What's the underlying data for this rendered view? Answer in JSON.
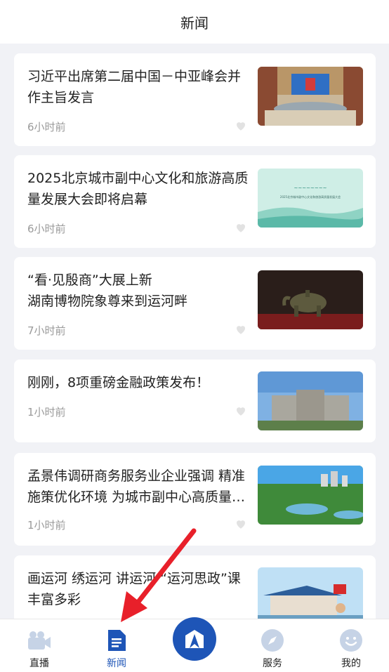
{
  "header": {
    "title": "新闻"
  },
  "news": [
    {
      "title": "习近平出席第二届中国－中亚峰会并作主旨发言",
      "time": "6小时前"
    },
    {
      "title": "2025北京城市副中心文化和旅游高质量发展大会即将启幕",
      "time": "6小时前",
      "thumb_text": "2025北京城市副中心文化和旅游高质量发展大会"
    },
    {
      "title": "“看·见殷商”大展上新\n湖南博物院象尊来到运河畔",
      "time": "7小时前"
    },
    {
      "title": "刚刚，8项重磅金融政策发布！",
      "time": "1小时前"
    },
    {
      "title": "孟景伟调研商务服务业企业强调 精准施策优化环境 为城市副中心高质量发展提供有力支撑",
      "time": "1小时前"
    },
    {
      "title": "画运河 绣运河 讲运河 “运河思政”课丰富多彩",
      "time": ""
    }
  ],
  "tabbar": {
    "items": [
      {
        "label": "直播",
        "icon": "video-camera-icon",
        "active": false
      },
      {
        "label": "新闻",
        "icon": "document-icon",
        "active": true
      },
      {
        "label": "",
        "icon": "home-logo-icon",
        "active": false
      },
      {
        "label": "服务",
        "icon": "compass-icon",
        "active": false
      },
      {
        "label": "我的",
        "icon": "smiley-icon",
        "active": false
      }
    ]
  },
  "colors": {
    "accent": "#1e55b7",
    "background": "#f1f2f6",
    "card": "#ffffff",
    "muted": "#9a9a9a",
    "annotation": "#e8202a"
  }
}
